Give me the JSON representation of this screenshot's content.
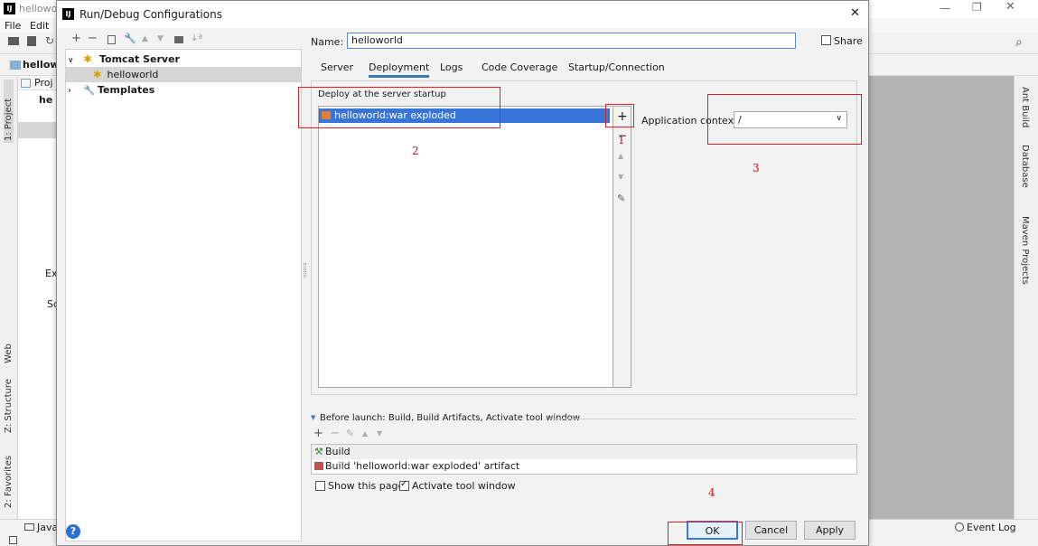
{
  "ide": {
    "title": "hellowor",
    "menu": {
      "file": "File",
      "edit": "Edit"
    },
    "project_name": "hellowo",
    "tree_project": "Proj",
    "tree_he": "he",
    "tree_ex": "Ex",
    "tree_sc": "Sc",
    "left_tabs": {
      "project": "1: Project",
      "web": "Web",
      "structure": "Z: Structure",
      "favorites": "2: Favorites"
    },
    "right_tabs": {
      "ant": "Ant Build",
      "database": "Database",
      "maven": "Maven Projects"
    },
    "bottom_java": "Java",
    "event_log": "Event Log"
  },
  "dialog": {
    "title": "Run/Debug Configurations",
    "name_label": "Name:",
    "name_value": "helloworld",
    "share_label": "Share",
    "tree": {
      "tomcat": "Tomcat Server",
      "helloworld": "helloworld",
      "templates": "Templates"
    },
    "tabs": [
      "Server",
      "Deployment",
      "Logs",
      "Code Coverage",
      "Startup/Connection"
    ],
    "deploy_label": "Deploy at the server startup",
    "artifact": "helloworld:war exploded",
    "app_context_label": "Application context:",
    "app_context_value": "/",
    "before_launch": "Before launch: Build, Build Artifacts, Activate tool window",
    "before_items": [
      "Build",
      "Build 'helloworld:war exploded' artifact"
    ],
    "show_page": "Show this page",
    "activate_tool": "Activate tool window",
    "buttons": {
      "ok": "OK",
      "cancel": "Cancel",
      "apply": "Apply"
    },
    "help": "?"
  },
  "annotations": [
    "1",
    "2",
    "3",
    "4"
  ],
  "colors": {
    "selection": "#3875d7",
    "annotation": "#e02020",
    "accent": "#3c78b4"
  }
}
